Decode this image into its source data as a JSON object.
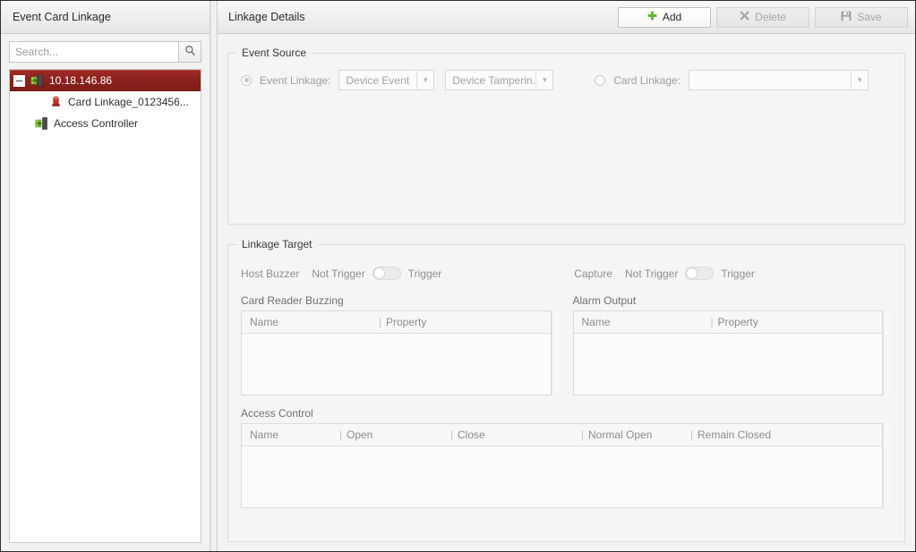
{
  "sidebar": {
    "header_title": "Event Card Linkage",
    "search": {
      "placeholder": "Search...",
      "value": "",
      "icon": "search-icon"
    },
    "tree": [
      {
        "label": "10.18.146.86",
        "icon": "device-door-icon",
        "expander": "minus-icon",
        "selected": true,
        "level": 1
      },
      {
        "label": "Card Linkage_0123456...",
        "icon": "alarm-siren-icon",
        "selected": false,
        "level": 2
      },
      {
        "label": "Access Controller",
        "icon": "access-controller-icon",
        "selected": false,
        "level": 1
      }
    ]
  },
  "details": {
    "header_title": "Linkage Details",
    "toolbar": {
      "add_label": "Add",
      "add_icon": "plus-icon",
      "add_enabled": true,
      "delete_label": "Delete",
      "delete_icon": "cross-icon",
      "delete_enabled": false,
      "save_label": "Save",
      "save_icon": "floppy-disk-icon",
      "save_enabled": false
    },
    "event_source": {
      "group_title": "Event Source",
      "event_linkage_label": "Event Linkage:",
      "event_linkage_radio_selected": true,
      "event_type_value": "Device Event",
      "event_name_value": "Device Tamperin...",
      "card_linkage_label": "Card Linkage:",
      "card_linkage_radio_selected": false,
      "card_linkage_value": "",
      "dropdown_arrow": "chevron-down-icon"
    },
    "linkage_target": {
      "group_title": "Linkage Target",
      "host_buzzer": {
        "name": "Host Buzzer",
        "off_label": "Not Trigger",
        "on_label": "Trigger",
        "state": "off"
      },
      "capture": {
        "name": "Capture",
        "off_label": "Not Trigger",
        "on_label": "Trigger",
        "state": "off"
      },
      "card_reader_buzzing": {
        "caption": "Card Reader Buzzing",
        "columns": [
          "Name",
          "Property"
        ],
        "rows": []
      },
      "alarm_output": {
        "caption": "Alarm Output",
        "columns": [
          "Name",
          "Property"
        ],
        "rows": []
      },
      "access_control": {
        "caption": "Access Control",
        "columns": [
          "Name",
          "Open",
          "Close",
          "Normal Open",
          "Remain Closed"
        ],
        "rows": []
      }
    }
  },
  "colors": {
    "selection_red": "#8a211c",
    "accent_green": "#5cb82f",
    "panel_bg": "#f3f3f3",
    "border": "#dcdcdc"
  }
}
